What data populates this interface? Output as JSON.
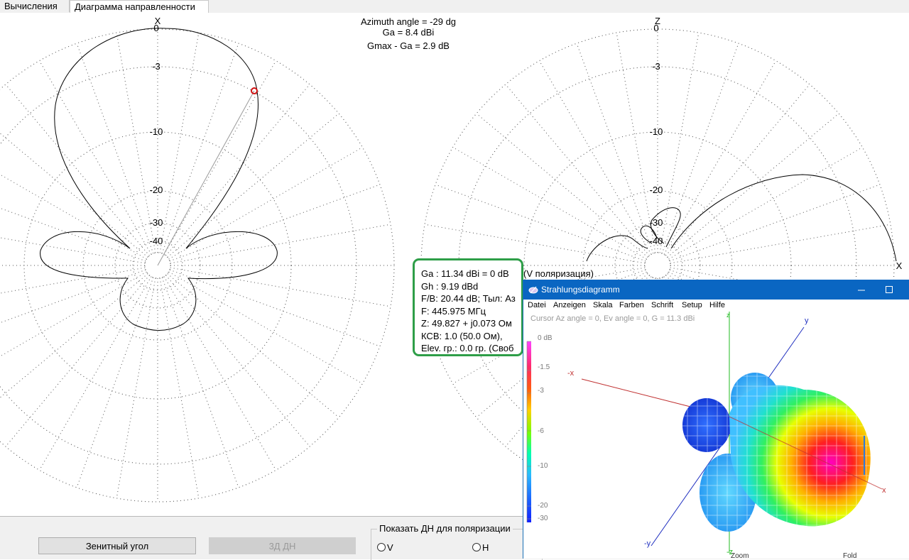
{
  "tabs": [
    {
      "label": "Вычисления"
    },
    {
      "label": "Диаграмма направленности"
    }
  ],
  "plot": {
    "header": {
      "azimuth": "Azimuth angle = -29 dg",
      "ga": "Ga = 8.4 dBi",
      "gmax": "Gmax - Ga = 2.9 dB"
    },
    "left_axis_label": "X",
    "right_axis_label": "Z",
    "right_side_label": "X",
    "ring_labels": [
      "0",
      "-3",
      "-10",
      "-20",
      "-30",
      "-40"
    ],
    "colors": {
      "grid": "#555555",
      "pattern": "#000000",
      "cursor": "#d01010",
      "cursor_line": "#9a9a9a"
    }
  },
  "info": {
    "lines": [
      "Ga : 11.34 dBi = 0 dB",
      "Gh : 9.19 dBd",
      "F/B: 20.44 dB; Тыл: Аз",
      "F: 445.975 МГц",
      "Z: 49.827 + j0.073 Ом",
      "КСВ: 1.0 (50.0 Ом),",
      "Elev. гр.: 0.0 гр. (Своб"
    ],
    "overflow_text": "(V поляризация)",
    "border_color": "#2e9e48"
  },
  "bottom": {
    "zenith_button": "Зенитный угол",
    "pattern3d_button": "3Д  ДН",
    "polarization_group": "Показать ДН для поляризации",
    "radio_v": "V",
    "radio_h": "H"
  },
  "window3d": {
    "title": "Strahlungsdiagramm",
    "menu": [
      "Datei",
      "Anzeigen",
      "Skala",
      "Farben",
      "Schrift",
      "Setup",
      "Hilfe"
    ],
    "cursor_text": "Cursor Az angle = 0,  Ev angle = 0,  G = 11.3 dBi",
    "scale_labels": [
      "0 dB",
      "-1.5",
      "-3",
      "-6",
      "-10",
      "-20",
      "-30"
    ],
    "axis_labels": {
      "minus_x": "-x",
      "plus_x": "x",
      "plus_y": "y",
      "minus_y": "-y",
      "z_top": "z",
      "z_bottom": "-z"
    },
    "footer_left": "Zoom",
    "footer_right": "Fold"
  }
}
